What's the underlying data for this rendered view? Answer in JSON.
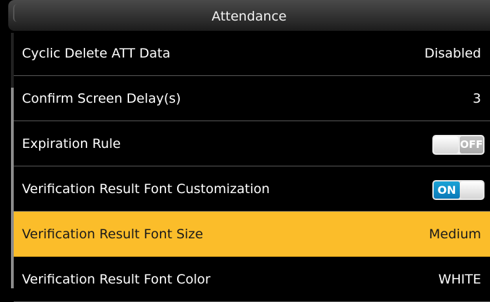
{
  "header": {
    "title": "Attendance"
  },
  "rows": [
    {
      "label": "Cyclic Delete ATT Data",
      "value": "Disabled"
    },
    {
      "label": "Confirm Screen Delay(s)",
      "value": "3"
    },
    {
      "label": "Expiration Rule",
      "toggle": "OFF"
    },
    {
      "label": "Verification Result Font Customization",
      "toggle": "ON"
    },
    {
      "label": "Verification Result Font Size",
      "value": "Medium",
      "selected": true
    },
    {
      "label": "Verification Result Font Color",
      "value": "WHITE"
    }
  ],
  "colors": {
    "highlight": "#fbbd2a",
    "toggle_on": "#0a79b8",
    "background": "#000000"
  }
}
